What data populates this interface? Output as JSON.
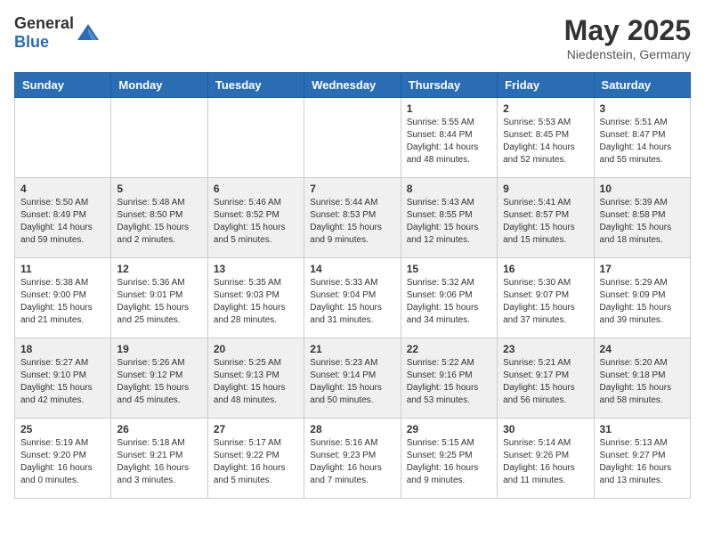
{
  "header": {
    "logo_general": "General",
    "logo_blue": "Blue",
    "month_year": "May 2025",
    "location": "Niedenstein, Germany"
  },
  "weekdays": [
    "Sunday",
    "Monday",
    "Tuesday",
    "Wednesday",
    "Thursday",
    "Friday",
    "Saturday"
  ],
  "weeks": [
    [
      {
        "day": "",
        "info": ""
      },
      {
        "day": "",
        "info": ""
      },
      {
        "day": "",
        "info": ""
      },
      {
        "day": "",
        "info": ""
      },
      {
        "day": "1",
        "info": "Sunrise: 5:55 AM\nSunset: 8:44 PM\nDaylight: 14 hours\nand 48 minutes."
      },
      {
        "day": "2",
        "info": "Sunrise: 5:53 AM\nSunset: 8:45 PM\nDaylight: 14 hours\nand 52 minutes."
      },
      {
        "day": "3",
        "info": "Sunrise: 5:51 AM\nSunset: 8:47 PM\nDaylight: 14 hours\nand 55 minutes."
      }
    ],
    [
      {
        "day": "4",
        "info": "Sunrise: 5:50 AM\nSunset: 8:49 PM\nDaylight: 14 hours\nand 59 minutes."
      },
      {
        "day": "5",
        "info": "Sunrise: 5:48 AM\nSunset: 8:50 PM\nDaylight: 15 hours\nand 2 minutes."
      },
      {
        "day": "6",
        "info": "Sunrise: 5:46 AM\nSunset: 8:52 PM\nDaylight: 15 hours\nand 5 minutes."
      },
      {
        "day": "7",
        "info": "Sunrise: 5:44 AM\nSunset: 8:53 PM\nDaylight: 15 hours\nand 9 minutes."
      },
      {
        "day": "8",
        "info": "Sunrise: 5:43 AM\nSunset: 8:55 PM\nDaylight: 15 hours\nand 12 minutes."
      },
      {
        "day": "9",
        "info": "Sunrise: 5:41 AM\nSunset: 8:57 PM\nDaylight: 15 hours\nand 15 minutes."
      },
      {
        "day": "10",
        "info": "Sunrise: 5:39 AM\nSunset: 8:58 PM\nDaylight: 15 hours\nand 18 minutes."
      }
    ],
    [
      {
        "day": "11",
        "info": "Sunrise: 5:38 AM\nSunset: 9:00 PM\nDaylight: 15 hours\nand 21 minutes."
      },
      {
        "day": "12",
        "info": "Sunrise: 5:36 AM\nSunset: 9:01 PM\nDaylight: 15 hours\nand 25 minutes."
      },
      {
        "day": "13",
        "info": "Sunrise: 5:35 AM\nSunset: 9:03 PM\nDaylight: 15 hours\nand 28 minutes."
      },
      {
        "day": "14",
        "info": "Sunrise: 5:33 AM\nSunset: 9:04 PM\nDaylight: 15 hours\nand 31 minutes."
      },
      {
        "day": "15",
        "info": "Sunrise: 5:32 AM\nSunset: 9:06 PM\nDaylight: 15 hours\nand 34 minutes."
      },
      {
        "day": "16",
        "info": "Sunrise: 5:30 AM\nSunset: 9:07 PM\nDaylight: 15 hours\nand 37 minutes."
      },
      {
        "day": "17",
        "info": "Sunrise: 5:29 AM\nSunset: 9:09 PM\nDaylight: 15 hours\nand 39 minutes."
      }
    ],
    [
      {
        "day": "18",
        "info": "Sunrise: 5:27 AM\nSunset: 9:10 PM\nDaylight: 15 hours\nand 42 minutes."
      },
      {
        "day": "19",
        "info": "Sunrise: 5:26 AM\nSunset: 9:12 PM\nDaylight: 15 hours\nand 45 minutes."
      },
      {
        "day": "20",
        "info": "Sunrise: 5:25 AM\nSunset: 9:13 PM\nDaylight: 15 hours\nand 48 minutes."
      },
      {
        "day": "21",
        "info": "Sunrise: 5:23 AM\nSunset: 9:14 PM\nDaylight: 15 hours\nand 50 minutes."
      },
      {
        "day": "22",
        "info": "Sunrise: 5:22 AM\nSunset: 9:16 PM\nDaylight: 15 hours\nand 53 minutes."
      },
      {
        "day": "23",
        "info": "Sunrise: 5:21 AM\nSunset: 9:17 PM\nDaylight: 15 hours\nand 56 minutes."
      },
      {
        "day": "24",
        "info": "Sunrise: 5:20 AM\nSunset: 9:18 PM\nDaylight: 15 hours\nand 58 minutes."
      }
    ],
    [
      {
        "day": "25",
        "info": "Sunrise: 5:19 AM\nSunset: 9:20 PM\nDaylight: 16 hours\nand 0 minutes."
      },
      {
        "day": "26",
        "info": "Sunrise: 5:18 AM\nSunset: 9:21 PM\nDaylight: 16 hours\nand 3 minutes."
      },
      {
        "day": "27",
        "info": "Sunrise: 5:17 AM\nSunset: 9:22 PM\nDaylight: 16 hours\nand 5 minutes."
      },
      {
        "day": "28",
        "info": "Sunrise: 5:16 AM\nSunset: 9:23 PM\nDaylight: 16 hours\nand 7 minutes."
      },
      {
        "day": "29",
        "info": "Sunrise: 5:15 AM\nSunset: 9:25 PM\nDaylight: 16 hours\nand 9 minutes."
      },
      {
        "day": "30",
        "info": "Sunrise: 5:14 AM\nSunset: 9:26 PM\nDaylight: 16 hours\nand 11 minutes."
      },
      {
        "day": "31",
        "info": "Sunrise: 5:13 AM\nSunset: 9:27 PM\nDaylight: 16 hours\nand 13 minutes."
      }
    ]
  ]
}
